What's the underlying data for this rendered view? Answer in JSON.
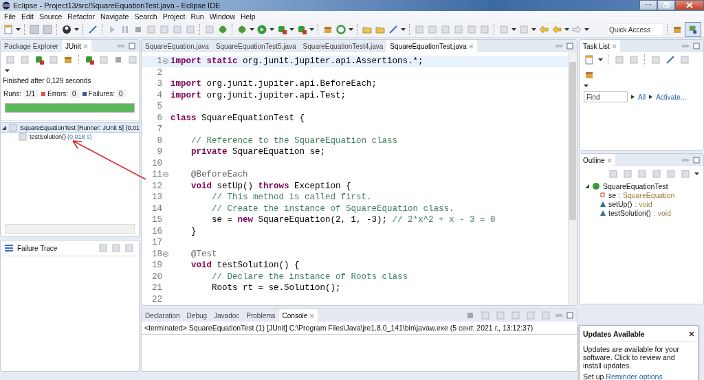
{
  "window": {
    "title": "Eclipse - Project13/src/SquareEquationTest.java - Eclipse IDE"
  },
  "menu": [
    "File",
    "Edit",
    "Source",
    "Refactor",
    "Navigate",
    "Search",
    "Project",
    "Run",
    "Window",
    "Help"
  ],
  "toolbar": {
    "quick_access": {
      "placeholder": "Quick Access"
    }
  },
  "junit_view": {
    "tabs": [
      {
        "label": "Package Explorer",
        "selected": false
      },
      {
        "label": "JUnit",
        "selected": true
      }
    ],
    "status": "Finished after 0,129 seconds",
    "counters": [
      {
        "kind": "runs",
        "label": "Runs:",
        "value": "1/1"
      },
      {
        "kind": "errors",
        "label": "Errors:",
        "value": "0"
      },
      {
        "kind": "failures",
        "label": "Failures:",
        "value": "0"
      }
    ],
    "progress": {
      "level": 1,
      "color": "#5cb85c"
    },
    "tree": [
      {
        "label": "SquareEquationTest [Runner: JUnit 5] (0,01",
        "selected": true,
        "expanded": true,
        "children": [
          {
            "label": "testSolution()",
            "time": "(0,018 s)",
            "selected": false
          }
        ]
      }
    ],
    "failure_trace": {
      "title": "Failure Trace"
    }
  },
  "editor": {
    "tabs": [
      {
        "label": "SquareEquation.java",
        "selected": false
      },
      {
        "label": "SquareEquationTest5.java",
        "selected": false
      },
      {
        "label": "SquareEquationTest4.java",
        "selected": false
      },
      {
        "label": "SquareEquationTest.java",
        "selected": true
      }
    ],
    "lines": [
      {
        "num": "1",
        "fold": true,
        "current": true,
        "tokens": [
          {
            "kind": "keyword",
            "text": "import static"
          },
          {
            "kind": "plain",
            "text": " org.junit.jupiter.api.Assertions.*;"
          }
        ]
      },
      {
        "num": "2",
        "fold": false,
        "current": false
      },
      {
        "num": "3",
        "fold": false,
        "current": false,
        "tokens": [
          {
            "kind": "keyword",
            "text": "import"
          },
          {
            "kind": "plain",
            "text": " org.junit.jupiter.api.BeforeEach;"
          }
        ]
      },
      {
        "num": "4",
        "fold": false,
        "current": false,
        "tokens": [
          {
            "kind": "keyword",
            "text": "import"
          },
          {
            "kind": "plain",
            "text": " org.junit.jupiter.api.Test;"
          }
        ]
      },
      {
        "num": "5",
        "fold": false,
        "current": false
      },
      {
        "num": "6",
        "fold": false,
        "current": false,
        "tokens": [
          {
            "kind": "keyword",
            "text": "class"
          },
          {
            "kind": "plain",
            "text": " SquareEquationTest {"
          }
        ]
      },
      {
        "num": "7",
        "fold": false,
        "current": false
      },
      {
        "num": "8",
        "fold": false,
        "current": false,
        "tokens": [
          {
            "kind": "comment",
            "text": "    // Reference to the SquareEquation class"
          }
        ]
      },
      {
        "num": "9",
        "fold": false,
        "current": false,
        "tokens": [
          {
            "kind": "keyword",
            "text": "    private"
          },
          {
            "kind": "plain",
            "text": " SquareEquation se;"
          }
        ]
      },
      {
        "num": "10",
        "fold": false,
        "current": false
      },
      {
        "num": "11",
        "fold": true,
        "current": false,
        "tokens": [
          {
            "kind": "annotation",
            "text": "    @BeforeEach"
          }
        ]
      },
      {
        "num": "12",
        "fold": false,
        "current": false,
        "tokens": [
          {
            "kind": "keyword",
            "text": "    void"
          },
          {
            "kind": "plain",
            "text": " setUp() "
          },
          {
            "kind": "keyword",
            "text": "throws"
          },
          {
            "kind": "plain",
            "text": " Exception {"
          }
        ]
      },
      {
        "num": "13",
        "fold": false,
        "current": false,
        "tokens": [
          {
            "kind": "comment",
            "text": "        // This method is called first."
          }
        ]
      },
      {
        "num": "14",
        "fold": false,
        "current": false,
        "tokens": [
          {
            "kind": "comment",
            "text": "        // Create the instance of SquareEquation class."
          }
        ]
      },
      {
        "num": "15",
        "fold": false,
        "current": false,
        "tokens": [
          {
            "kind": "plain",
            "text": "        se = "
          },
          {
            "kind": "keyword",
            "text": "new"
          },
          {
            "kind": "plain",
            "text": " SquareEquation(2, 1, -3); "
          },
          {
            "kind": "comment",
            "text": "// 2*x^2 + x - 3 = 0"
          }
        ]
      },
      {
        "num": "16",
        "fold": false,
        "current": false,
        "tokens": [
          {
            "kind": "plain",
            "text": "    }"
          }
        ]
      },
      {
        "num": "17",
        "fold": false,
        "current": false
      },
      {
        "num": "18",
        "fold": true,
        "current": false,
        "tokens": [
          {
            "kind": "annotation",
            "text": "    @Test"
          }
        ]
      },
      {
        "num": "19",
        "fold": false,
        "current": false,
        "tokens": [
          {
            "kind": "keyword",
            "text": "    void"
          },
          {
            "kind": "plain",
            "text": " testSolution() {"
          }
        ]
      },
      {
        "num": "20",
        "fold": false,
        "current": false,
        "tokens": [
          {
            "kind": "comment",
            "text": "        // Declare the instance of Roots class"
          }
        ]
      },
      {
        "num": "21",
        "fold": false,
        "current": false,
        "tokens": [
          {
            "kind": "plain",
            "text": "        Roots rt = se.Solution();"
          }
        ]
      },
      {
        "num": "22",
        "fold": false,
        "current": false
      }
    ]
  },
  "console_view": {
    "tabs": [
      {
        "label": "Declaration",
        "selected": false
      },
      {
        "label": "Debug",
        "selected": false
      },
      {
        "label": "Javadoc",
        "selected": false
      },
      {
        "label": "Problems",
        "selected": false
      },
      {
        "label": "Console",
        "selected": true
      }
    ],
    "output": "<terminated> SquareEquationTest (1) [JUnit] C:\\Program Files\\Java\\jre1.8.0_141\\bin\\javaw.exe (5 сент. 2021 г., 13:12:37)"
  },
  "task_list": {
    "title": "Task List",
    "find": {
      "placeholder": "Find"
    },
    "links": [
      "All",
      "Activate..."
    ]
  },
  "outline": {
    "title": "Outline",
    "root": {
      "label": "SquareEquationTest",
      "expanded": true,
      "children": [
        {
          "kind": "field",
          "name": "se",
          "type": ": SquareEquation"
        },
        {
          "kind": "method",
          "name": "setUp()",
          "type": ": void"
        },
        {
          "kind": "method",
          "name": "testSolution()",
          "type": ": void"
        }
      ]
    }
  },
  "updates_popup": {
    "title": "Updates Available",
    "message": "Updates are available for your software. Click to review and install updates.",
    "setup_prefix": "Set up",
    "setup_link": "Reminder options"
  }
}
